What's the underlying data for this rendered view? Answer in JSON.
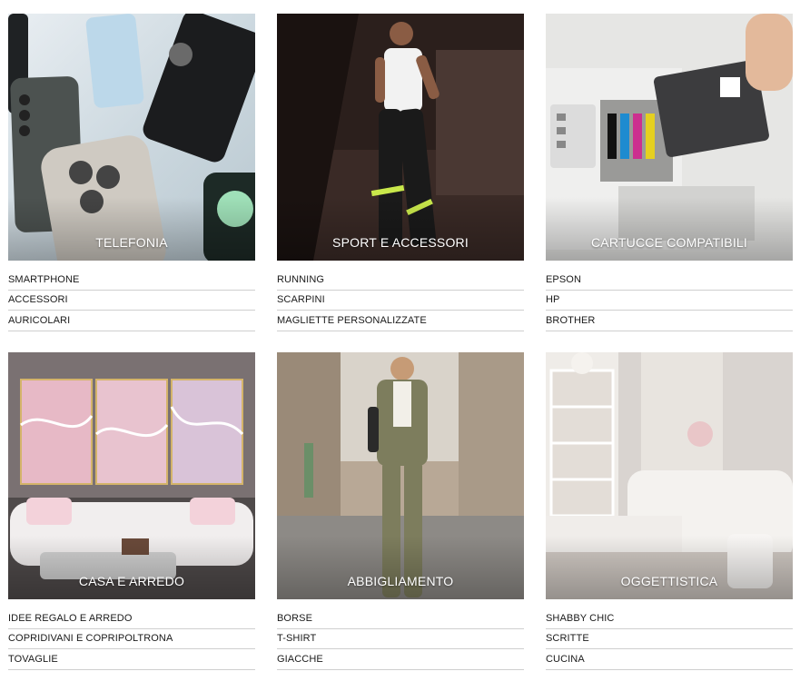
{
  "categories": [
    {
      "title": "TELEFONIA",
      "image": "phones-collage",
      "links": [
        "SMARTPHONE",
        "ACCESSORI",
        "AURICOLARI"
      ]
    },
    {
      "title": "SPORT E ACCESSORI",
      "image": "man-sportswear",
      "links": [
        "RUNNING",
        "SCARPINI",
        "MAGLIETTE PERSONALIZZATE"
      ]
    },
    {
      "title": "CARTUCCE COMPATIBILI",
      "image": "printer-cartridge",
      "links": [
        "EPSON",
        "HP",
        "BROTHER"
      ]
    },
    {
      "title": "CASA E ARREDO",
      "image": "pink-living-room",
      "links": [
        "IDEE REGALO E ARREDO",
        "COPRIDIVANI E COPRIPOLTRONA",
        "TOVAGLIE"
      ]
    },
    {
      "title": "ABBIGLIAMENTO",
      "image": "woman-green-suit",
      "links": [
        "BORSE",
        "T-SHIRT",
        "GIACCHE"
      ]
    },
    {
      "title": "OGGETTISTICA",
      "image": "shabby-chic-room",
      "links": [
        "SHABBY CHIC",
        "SCRITTE",
        "CUCINA"
      ]
    }
  ]
}
